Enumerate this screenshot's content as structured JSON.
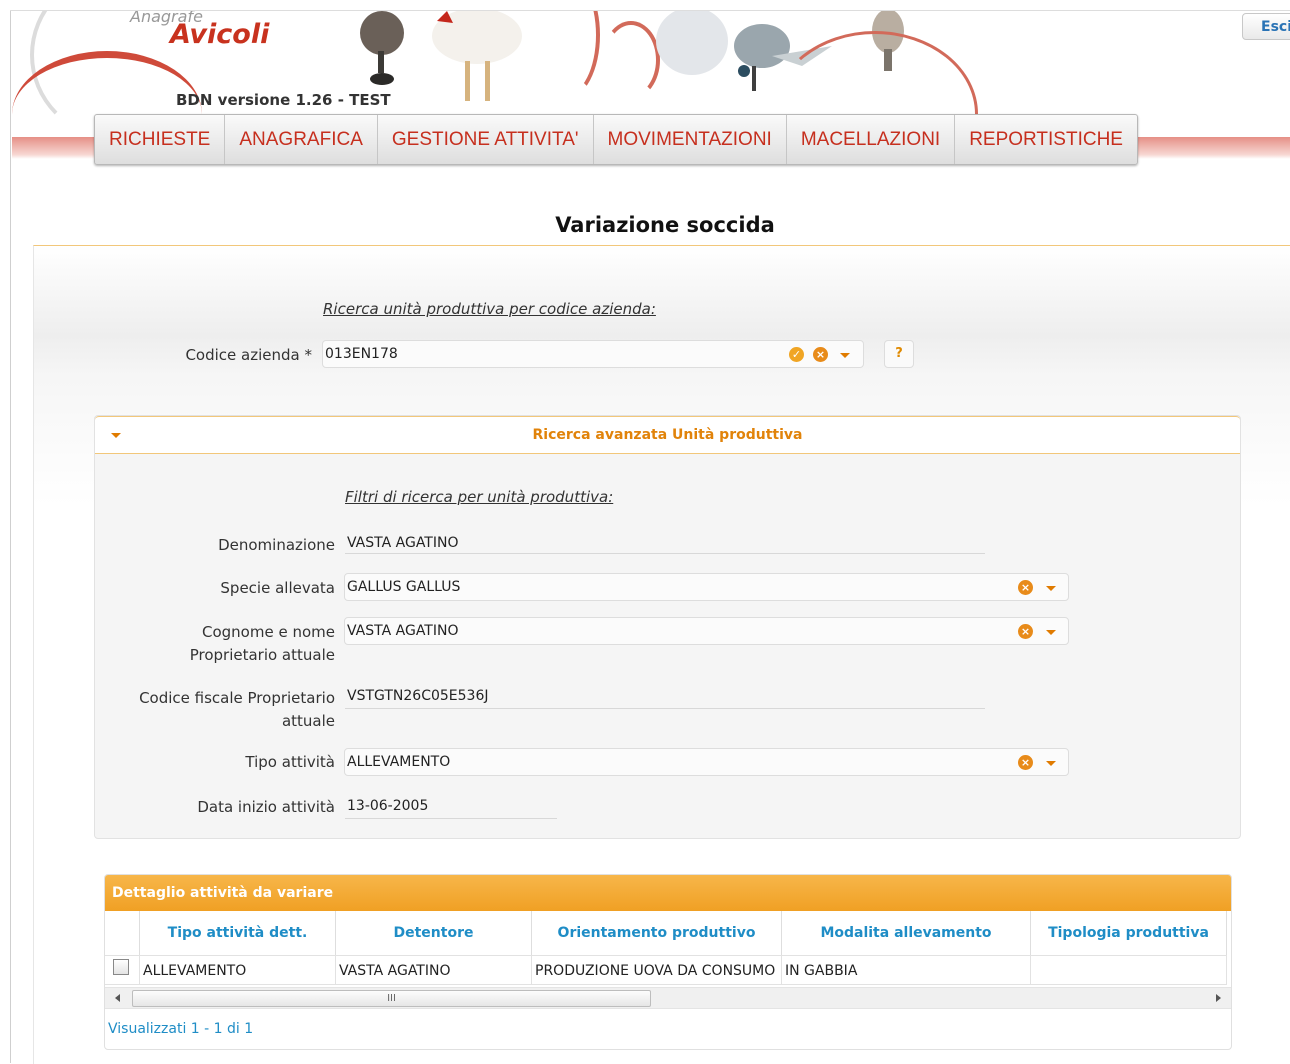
{
  "header": {
    "logo_top": "Anagrafe",
    "logo_title": "Avicoli",
    "version": "BDN versione 1.26  - TEST",
    "exit_label": "Esci"
  },
  "menu": [
    "RICHIESTE",
    "ANAGRAFICA",
    "GESTIONE ATTIVITA'",
    "MOVIMENTAZIONI",
    "MACELLAZIONI",
    "REPORTISTICHE"
  ],
  "page_title": "Variazione soccida",
  "search": {
    "heading": "Ricerca unità produttiva per codice azienda:",
    "codice_label": "Codice azienda *",
    "codice_value": "013EN178",
    "help_label": "?"
  },
  "advanced": {
    "title": "Ricerca avanzata Unità produttiva",
    "filters_heading": "Filtri di ricerca per unità produttiva:",
    "fields": {
      "denominazione": {
        "label": "Denominazione",
        "value": "VASTA AGATINO"
      },
      "specie": {
        "label": "Specie allevata",
        "value": "GALLUS GALLUS"
      },
      "cognome_line1": "Cognome e nome",
      "cognome_line2": "Proprietario attuale",
      "cognome_value": "VASTA AGATINO",
      "cf_line1": "Codice fiscale Proprietario",
      "cf_line2": "attuale",
      "cf_value": "VSTGTN26C05E536J",
      "tipo": {
        "label": "Tipo attività",
        "value": "ALLEVAMENTO"
      },
      "data": {
        "label": "Data inizio attività",
        "value": "13-06-2005"
      }
    }
  },
  "grid": {
    "caption": "Dettaglio attività da variare",
    "columns": [
      "Tipo attività dett.",
      "Detentore",
      "Orientamento produttivo",
      "Modalita allevamento",
      "Tipologia produttiva"
    ],
    "rows": [
      [
        "ALLEVAMENTO",
        "VASTA AGATINO",
        "PRODUZIONE UOVA DA CONSUMO",
        "IN GABBIA",
        ""
      ]
    ],
    "scroll_grip": "III",
    "footer": "Visualizzati 1 - 1 di 1"
  },
  "colors": {
    "accent_orange": "#f0a024",
    "menu_red": "#c62f1e",
    "link_blue": "#1f8dc6"
  }
}
